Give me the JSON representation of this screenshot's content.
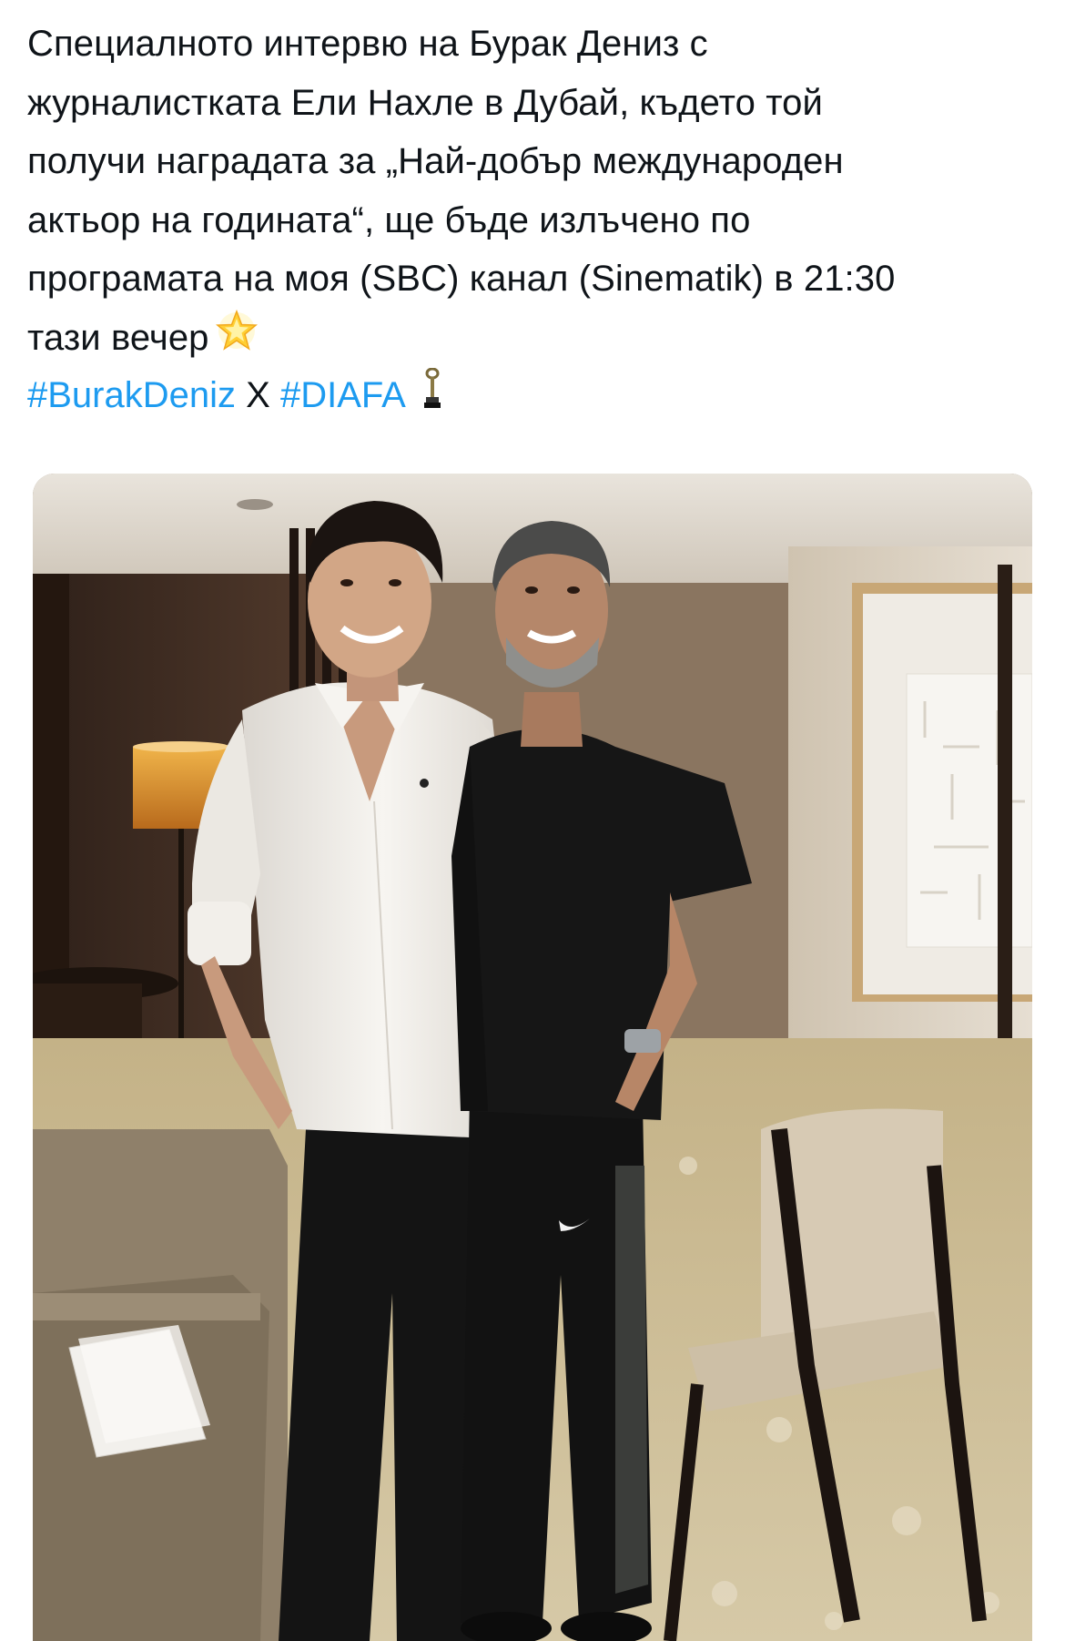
{
  "tweet": {
    "text_lines": [
      "Специалното интервю на Бурак Дениз с",
      "журналистката Ели Нахле в Дубай, където той",
      "получи наградата за „Най-добър международен",
      "актьор на годината“, ще бъде излъчено по",
      "програмата на моя (SBC) канал (Sinematik) в 21:30",
      "тази вечер"
    ],
    "emoji": "star-icon",
    "hashtags": [
      "#BurakDeniz",
      "#DIAFA"
    ],
    "separator": "X",
    "trailing_emoji": "trophy-icon"
  },
  "media": {
    "type": "photo",
    "logo_text": "SWOOSH",
    "colors": {
      "wall_dark": "#4a3527",
      "wall_light": "#d8cfc3",
      "carpet": "#c9b893",
      "shirt_white": "#f4f2ee",
      "shirt_black": "#151515",
      "sofa": "#8c7d66"
    }
  }
}
